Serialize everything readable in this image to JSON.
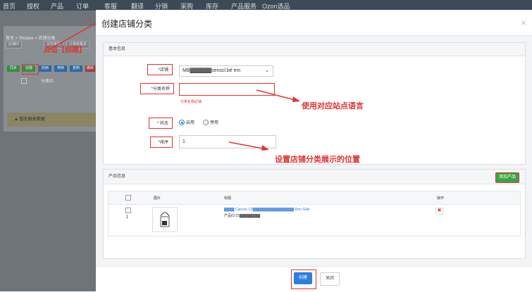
{
  "topnav": {
    "items": [
      "首页",
      "授权",
      "产品",
      "订单",
      "客服",
      "翻译",
      "分销",
      "采购",
      "库存",
      "产品服务",
      "Ozon选品"
    ]
  },
  "background": {
    "breadcrumb": "首页 > Shopee > 店铺分类",
    "filter_select": "店铺ID",
    "filter_btn1": "文件菜单",
    "filter_btn2": "分类收集夹",
    "action_btns": [
      "同步",
      "创建",
      "启用",
      "停用",
      "复制",
      "删除"
    ],
    "col_header": "分类ID",
    "no_data": "暂无相关数据",
    "annotation": "点击【创建】"
  },
  "modal": {
    "title": "创建店铺分类",
    "close": "×",
    "section_basic": "基本信息",
    "store_label": "*店铺",
    "store_value": "MB▓▓▓▓▓▓senscl.bé em",
    "name_label": "*分类名称",
    "name_value": "",
    "name_error": "分类名称必填",
    "status_label": "* 状态",
    "status_on": "启用",
    "status_off": "停用",
    "sort_label": "*排序",
    "sort_value": "1",
    "section_products": "产品信息",
    "add_product": "添加产品",
    "columns": [
      "图片",
      "标题",
      "操作"
    ],
    "row": {
      "index": "1",
      "title": "▓▓▓▓ Canvas Cổ▓▓▓▓▓▓▓▓▓▓▓▓▓▓▓▓ Đơn Giản",
      "product_id": "产品ID:15▓▓▓▓▓▓▓▓"
    },
    "note_language": "使用对应站点语言",
    "note_position": "设置店铺分类展示的位置",
    "create_btn": "创建",
    "close_btn": "关闭"
  },
  "colors": {
    "accent": "#2e7de1",
    "green": "#3aa544",
    "red": "#e0332f"
  }
}
